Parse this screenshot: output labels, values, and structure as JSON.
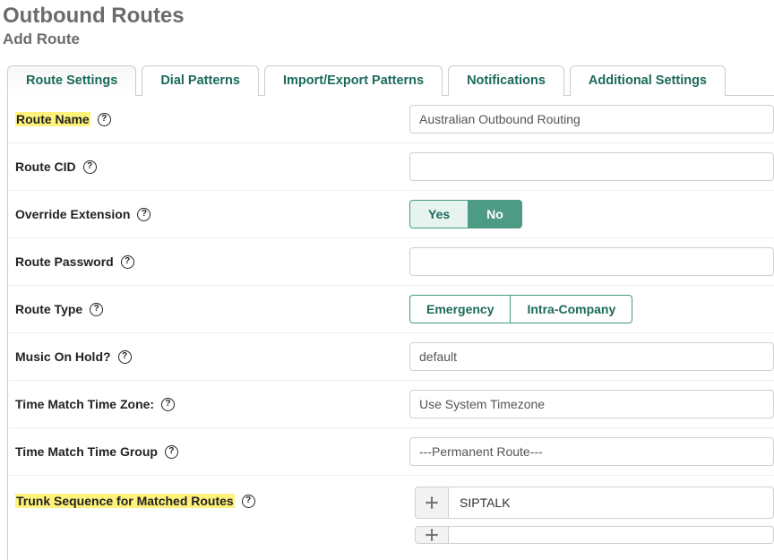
{
  "header": {
    "title": "Outbound Routes",
    "subtitle": "Add Route"
  },
  "tabs": {
    "route_settings": "Route Settings",
    "dial_patterns": "Dial Patterns",
    "import_export": "Import/Export Patterns",
    "notifications": "Notifications",
    "additional": "Additional Settings"
  },
  "fields": {
    "route_name": {
      "label": "Route Name",
      "value": "Australian Outbound Routing"
    },
    "route_cid": {
      "label": "Route CID",
      "value": ""
    },
    "override_ext": {
      "label": "Override Extension",
      "yes": "Yes",
      "no": "No"
    },
    "route_password": {
      "label": "Route Password",
      "value": ""
    },
    "route_type": {
      "label": "Route Type",
      "emergency": "Emergency",
      "intra": "Intra-Company"
    },
    "moh": {
      "label": "Music On Hold?",
      "value": "default"
    },
    "time_zone": {
      "label": "Time Match Time Zone:",
      "value": "Use System Timezone"
    },
    "time_group": {
      "label": "Time Match Time Group",
      "value": "---Permanent Route---"
    },
    "trunk_seq": {
      "label": "Trunk Sequence for Matched Routes"
    },
    "trunks": {
      "t0": "SIPTALK",
      "t1": ""
    }
  }
}
